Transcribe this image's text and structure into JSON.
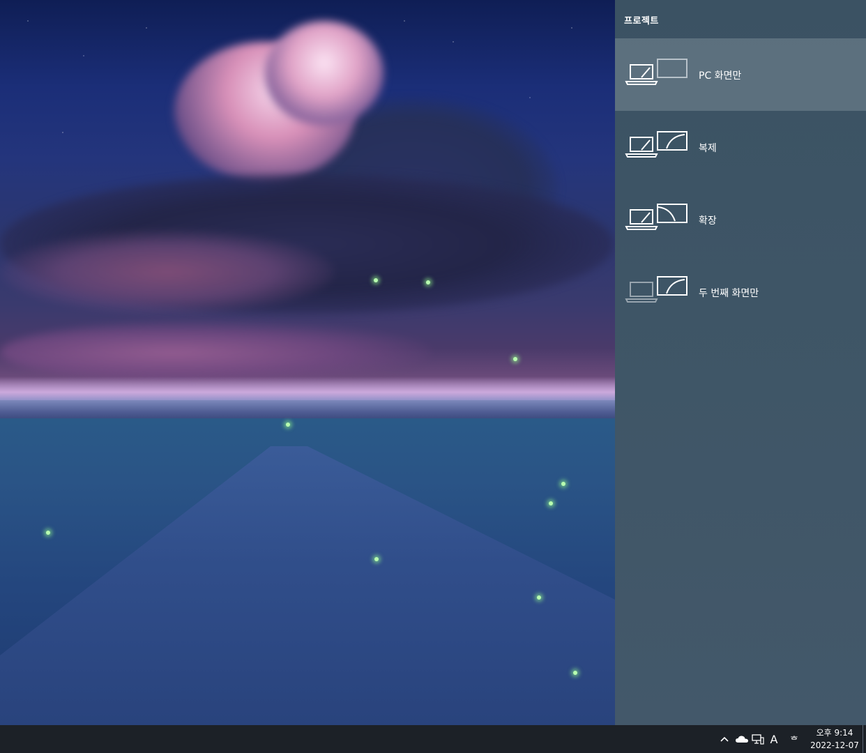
{
  "project_panel": {
    "title": "프로젝트",
    "options": [
      {
        "label": "PC 화면만",
        "icon": "pc-screen-only-icon",
        "selected": true
      },
      {
        "label": "복제",
        "icon": "duplicate-icon",
        "selected": false
      },
      {
        "label": "확장",
        "icon": "extend-icon",
        "selected": false
      },
      {
        "label": "두 번째 화면만",
        "icon": "second-screen-only-icon",
        "selected": false
      }
    ]
  },
  "taskbar": {
    "tray_icons": [
      "chevron-up-icon",
      "onedrive-cloud-icon",
      "network-icon"
    ],
    "ime_mode": "A",
    "ime_hangul": "ᄒ",
    "time": "오후 9:14",
    "date": "2022-12-07"
  },
  "colors": {
    "panel_bg": "#3e5566",
    "selected_bg": "#5d7080",
    "taskbar_bg": "#1c2127"
  }
}
